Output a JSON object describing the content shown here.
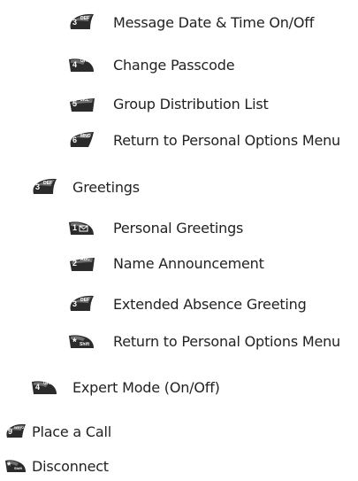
{
  "items": [
    {
      "key": "3",
      "sub": "DEF",
      "label": "Message Date & Time On/Off"
    },
    {
      "key": "4",
      "sub": "GHI",
      "label": "Change Passcode"
    },
    {
      "key": "5",
      "sub": "JKL",
      "label": "Group Distribution List"
    },
    {
      "key": "6",
      "sub": "MNO",
      "label": "Return to Personal Options Menu"
    },
    {
      "key": "3",
      "sub": "DEF",
      "label": "Greetings"
    },
    {
      "key": "1",
      "sub": "",
      "label": "Personal Greetings"
    },
    {
      "key": "2",
      "sub": "ABC",
      "label": "Name Announcement"
    },
    {
      "key": "3",
      "sub": "DEF",
      "label": "Extended Absence Greeting"
    },
    {
      "key": "*",
      "sub": "Shift",
      "label": "Return to Personal Options Menu"
    },
    {
      "key": "4",
      "sub": "GHI",
      "label": "Expert Mode (On/Off)"
    },
    {
      "key": "9",
      "sub": "WXYZ",
      "label": "Place a Call"
    },
    {
      "key": "*",
      "sub": "Shift",
      "label": "Disconnect"
    }
  ],
  "icon_names": [
    "key-3-icon",
    "key-4-icon",
    "key-5-icon",
    "key-6-icon",
    "key-3-icon",
    "key-1-icon",
    "key-2-icon",
    "key-3-icon",
    "key-star-icon",
    "key-4-icon",
    "key-9-icon",
    "key-star-icon"
  ],
  "colors": {
    "key_dark": "#2b2b2b",
    "key_light": "#a9a9a9",
    "text": "#222222"
  }
}
